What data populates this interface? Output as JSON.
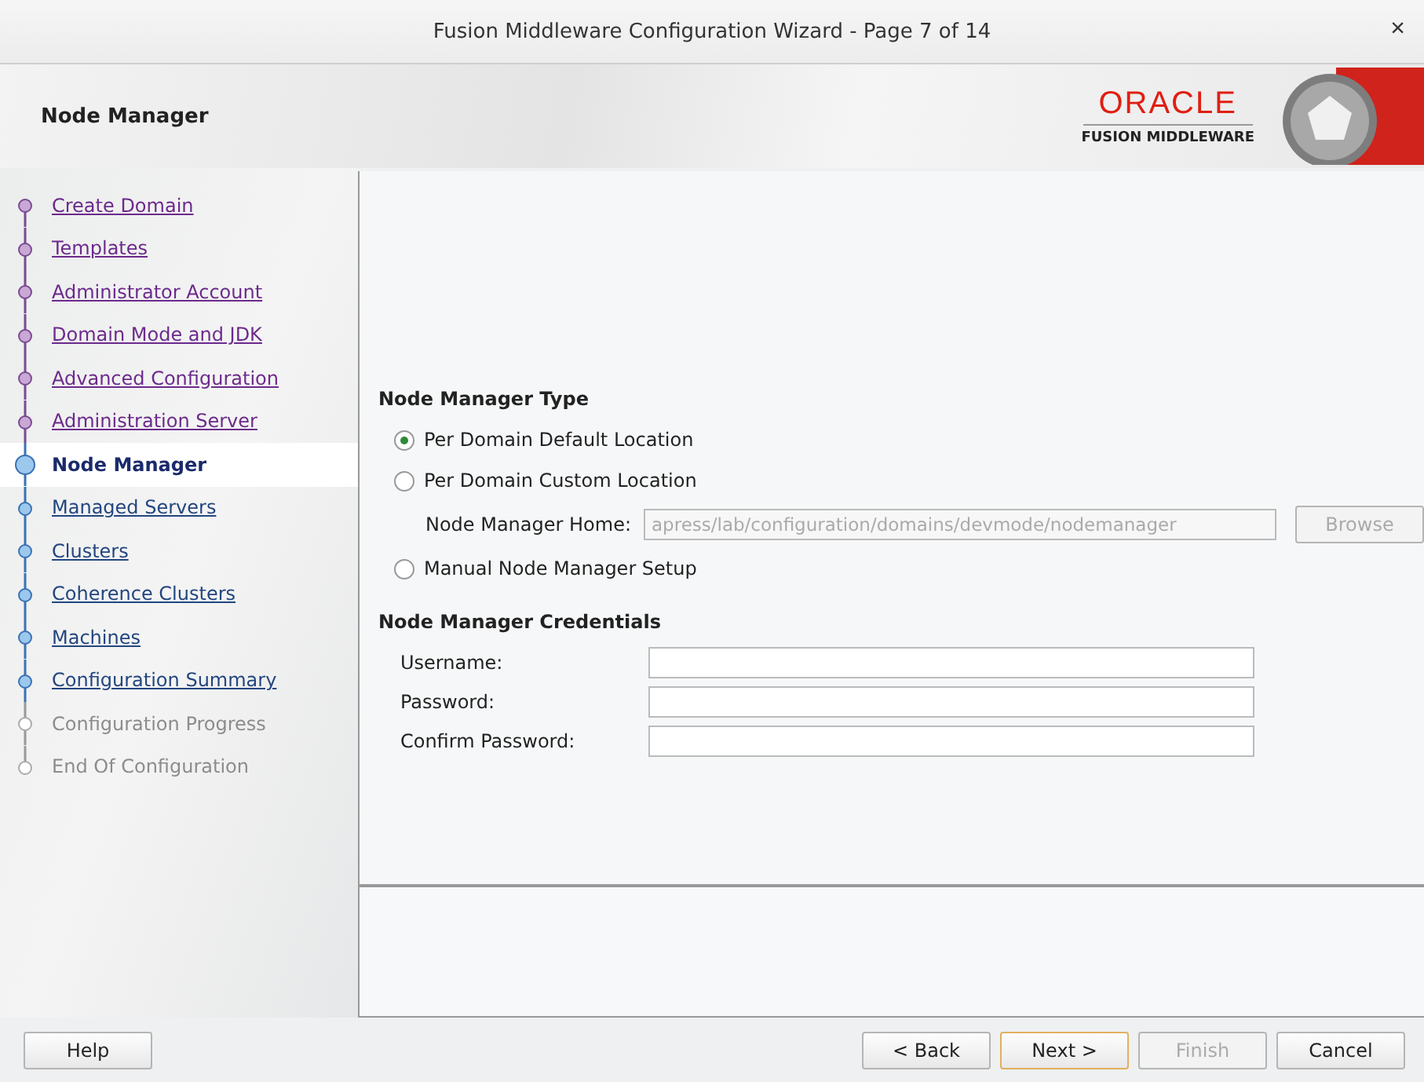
{
  "window": {
    "title": "Fusion Middleware Configuration Wizard - Page 7 of 14",
    "close": "×"
  },
  "header": {
    "title": "Node Manager",
    "logo_top": "ORACLE",
    "logo_bottom": "FUSION MIDDLEWARE"
  },
  "steps": [
    {
      "label": "Create Domain",
      "kind": "done",
      "selected": false
    },
    {
      "label": "Templates",
      "kind": "done",
      "selected": false
    },
    {
      "label": "Administrator Account",
      "kind": "done",
      "selected": false
    },
    {
      "label": "Domain Mode and JDK",
      "kind": "done",
      "selected": false
    },
    {
      "label": "Advanced Configuration",
      "kind": "done",
      "selected": false
    },
    {
      "label": "Administration Server",
      "kind": "done",
      "selected": false
    },
    {
      "label": "Node Manager",
      "kind": "current",
      "selected": true
    },
    {
      "label": "Managed Servers",
      "kind": "pending",
      "selected": false
    },
    {
      "label": "Clusters",
      "kind": "pending",
      "selected": false
    },
    {
      "label": "Coherence Clusters",
      "kind": "pending",
      "selected": false
    },
    {
      "label": "Machines",
      "kind": "pending",
      "selected": false
    },
    {
      "label": "Configuration Summary",
      "kind": "pending",
      "selected": false
    },
    {
      "label": "Configuration Progress",
      "kind": "disabled",
      "selected": false
    },
    {
      "label": "End Of Configuration",
      "kind": "disabled",
      "selected": false
    }
  ],
  "type_section": {
    "heading": "Node Manager Type",
    "options": [
      {
        "label": "Per Domain Default Location",
        "selected": true
      },
      {
        "label": "Per Domain Custom Location",
        "selected": false
      },
      {
        "label": "Manual Node Manager Setup",
        "selected": false
      }
    ],
    "home": {
      "label": "Node Manager Home:",
      "value": "apress/lab/configuration/domains/devmode/nodemanager",
      "disabled": true,
      "browse": "Browse"
    }
  },
  "credentials": {
    "heading": "Node Manager Credentials",
    "fields": [
      {
        "label": "Username:"
      },
      {
        "label": "Password:"
      },
      {
        "label": "Confirm Password:"
      }
    ]
  },
  "buttons": {
    "help": "Help",
    "back": "< Back",
    "next": "Next >",
    "finish": "Finish",
    "cancel": "Cancel",
    "finish_disabled": true
  }
}
